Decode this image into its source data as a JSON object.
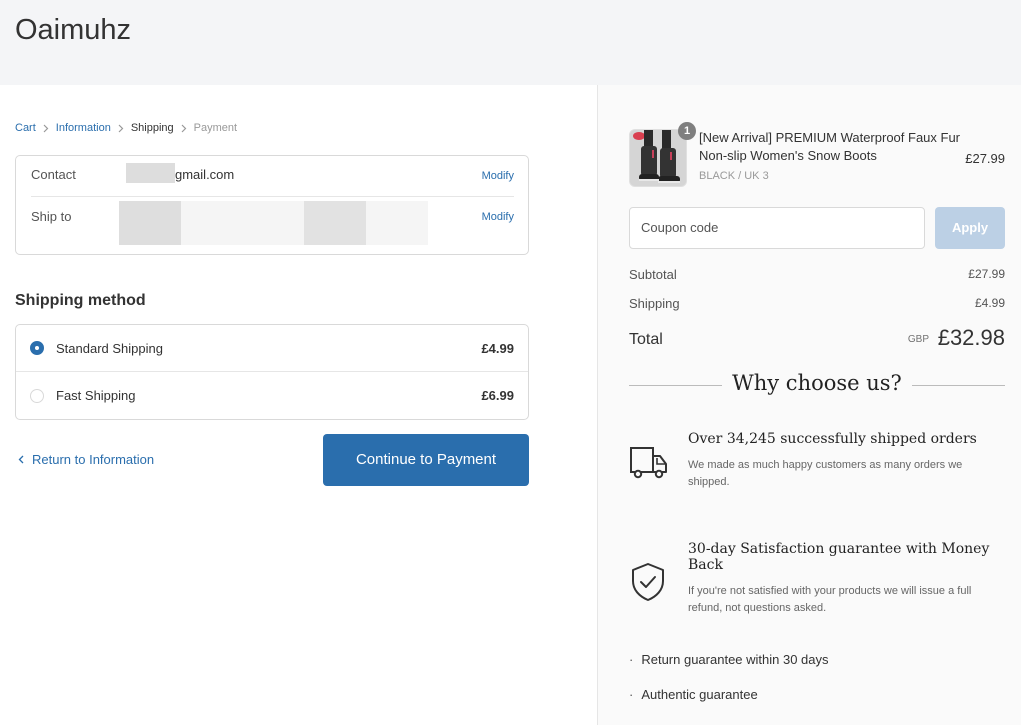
{
  "header": {
    "brand": "Oaimuhz"
  },
  "breadcrumb": [
    {
      "label": "Cart",
      "state": "link"
    },
    {
      "label": "Information",
      "state": "link"
    },
    {
      "label": "Shipping",
      "state": "current"
    },
    {
      "label": "Payment",
      "state": "upcoming"
    }
  ],
  "review": {
    "contact_label": "Contact",
    "contact_value_visible": "gmail.com",
    "ship_to_label": "Ship to",
    "modify_label": "Modify"
  },
  "shipping_method": {
    "title": "Shipping method",
    "options": [
      {
        "name": "Standard Shipping",
        "price": "£4.99",
        "selected": true
      },
      {
        "name": "Fast Shipping",
        "price": "£6.99",
        "selected": false
      }
    ]
  },
  "actions": {
    "return_label": "Return to Information",
    "continue_label": "Continue to Payment"
  },
  "order_summary": {
    "product": {
      "title": "[New Arrival] PREMIUM Waterproof Faux Fur Non-slip Women's Snow Boots",
      "variant": "BLACK / UK 3",
      "price": "£27.99",
      "quantity": "1"
    },
    "coupon": {
      "placeholder": "Coupon code",
      "apply_label": "Apply"
    },
    "subtotal_label": "Subtotal",
    "subtotal_value": "£27.99",
    "shipping_label": "Shipping",
    "shipping_value": "£4.99",
    "total_label": "Total",
    "total_currency": "GBP",
    "total_value": "£32.98"
  },
  "why_choose": {
    "title": "Why choose us?",
    "features": [
      {
        "icon": "truck-icon",
        "title": "Over 34,245 successfully shipped orders",
        "desc": "We made as much happy customers as many orders we shipped."
      },
      {
        "icon": "shield-check-icon",
        "title": "30-day Satisfaction guarantee with Money Back",
        "desc": "If you're not satisfied with your products we will issue a full refund, not questions asked."
      }
    ],
    "bullets": [
      "Return guarantee within 30 days",
      "Authentic guarantee"
    ]
  },
  "colors": {
    "accent": "#2a6ead",
    "apply_disabled": "#bcd0e5",
    "header_bg": "#f4f5f7",
    "sidebar_bg": "#fafafa"
  }
}
